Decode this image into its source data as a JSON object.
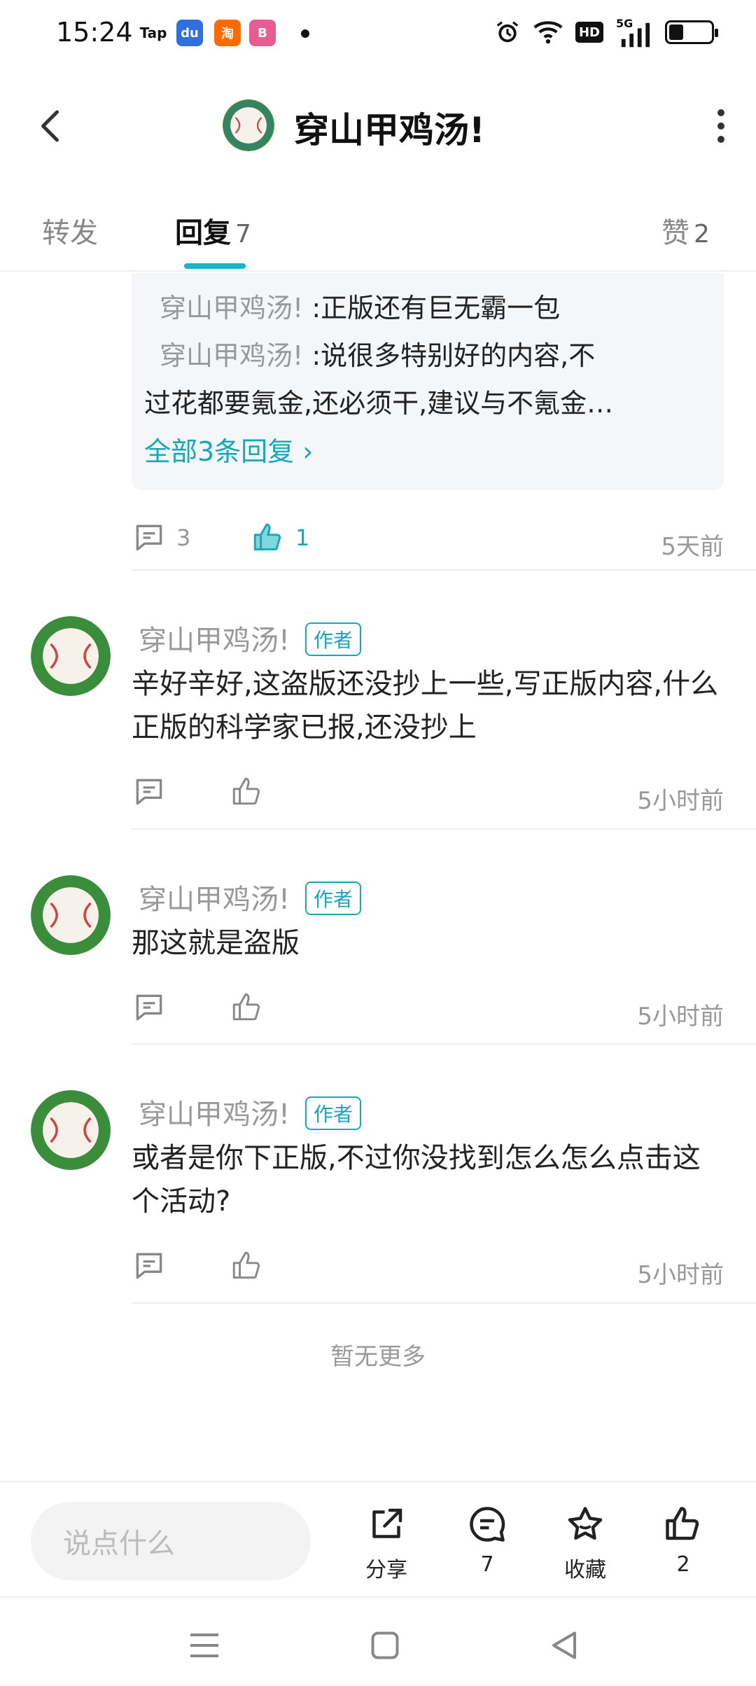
{
  "status_bar": {
    "time": "15:24",
    "apps": [
      "Tap",
      "baidu-app",
      "taobao-app",
      "bilibili-app"
    ],
    "icons": [
      "alarm-icon",
      "wifi-icon",
      "hd-icon",
      "signal-5g-icon",
      "battery-icon"
    ],
    "hd_label": "HD",
    "network_label": "5G"
  },
  "header": {
    "title": "穿山甲鸡汤!",
    "avatar": "baseball-avatar"
  },
  "tabs": [
    {
      "label": "转发",
      "count": ""
    },
    {
      "label": "回复",
      "count": "7"
    },
    {
      "label": "赞",
      "count": "2"
    }
  ],
  "reply_box": {
    "lines": [
      {
        "who": "穿山甲鸡汤!",
        "text": ":正版还有巨无霸一包"
      },
      {
        "who": "穿山甲鸡汤!",
        "text": ":说很多特别好的内容,不"
      }
    ],
    "continuation": "过花都要氪金,还必须干,建议与不氪金…",
    "all_replies": "全部3条回复 ›"
  },
  "first_actions": {
    "comments": "3",
    "likes": "1",
    "time": "5天前"
  },
  "comments": [
    {
      "name": "穿山甲鸡汤!",
      "badge": "作者",
      "text": "辛好辛好,这盗版还没抄上一些,写正版内容,什么正版的科学家已报,还没抄上",
      "time": "5小时前"
    },
    {
      "name": "穿山甲鸡汤!",
      "badge": "作者",
      "text": "那这就是盗版",
      "time": "5小时前"
    },
    {
      "name": "穿山甲鸡汤!",
      "badge": "作者",
      "text": "或者是你下正版,不过你没找到怎么怎么点击这个活动?",
      "time": "5小时前"
    }
  ],
  "no_more": "暂无更多",
  "bottom_bar": {
    "input_placeholder": "说点什么",
    "share": "分享",
    "comments": "7",
    "favorite": "收藏",
    "likes": "2"
  },
  "colors": {
    "accent": "#14b8c4",
    "text": "#222222",
    "muted": "#999999"
  }
}
